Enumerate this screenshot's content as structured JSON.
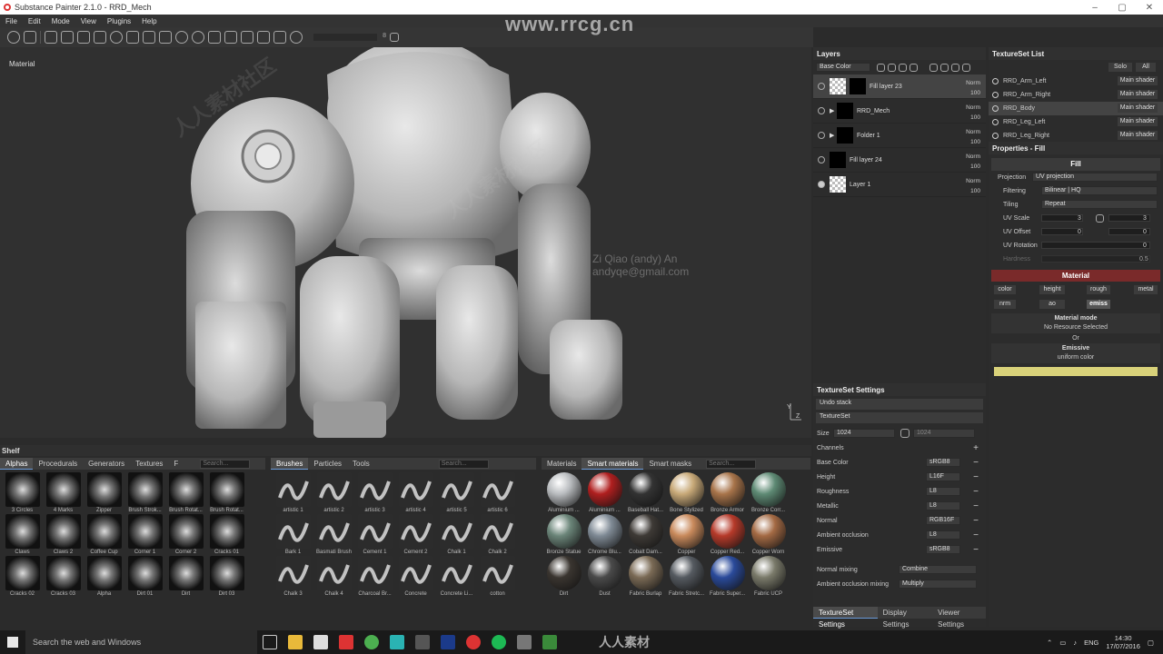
{
  "window": {
    "title": "Substance Painter 2.1.0 - RRD_Mech"
  },
  "watermark": {
    "site": "www.rrcg.cn",
    "cn": "人人素材社区",
    "logo_text": "人人素材",
    "author_name": "Zi Qiao (andy) An",
    "author_email": "andyqe@gmail.com"
  },
  "menu": [
    "File",
    "Edit",
    "Mode",
    "View",
    "Plugins",
    "Help"
  ],
  "toolbar": {
    "slider_value": "8"
  },
  "viewport": {
    "label": "Material",
    "gizmo_axes": "Y Z"
  },
  "shelf": {
    "title": "Shelf",
    "left_tabs": [
      "Alphas",
      "Procedurals",
      "Generators",
      "Textures",
      "F"
    ],
    "search_placeholder": "Search...",
    "alphas": [
      "3 Circles",
      "4 Marks",
      "Zipper",
      "Brush Strok...",
      "Brush Rotat...",
      "Brush Rotat...",
      "Claws",
      "Claws 2",
      "Coffee Cup",
      "Corner 1",
      "Corner 2",
      "Cracks 01",
      "Cracks 02",
      "Cracks 03",
      "Alpha",
      "Dirt 01",
      "Dirt",
      "Dirt 03"
    ],
    "mid_tabs": [
      "Brushes",
      "Particles",
      "Tools"
    ],
    "brushes": [
      "artistic 1",
      "artistic 2",
      "artistic 3",
      "artistic 4",
      "artistic 5",
      "artistic 6",
      "Bark 1",
      "Basmati Brush",
      "Cement 1",
      "Cement 2",
      "Chalk 1",
      "Chalk 2",
      "Chalk 3",
      "Chalk 4",
      "Charcoal Br...",
      "Concrete",
      "Concrete Li...",
      "cotton"
    ],
    "right_tabs": [
      "Materials",
      "Smart materials",
      "Smart masks"
    ],
    "materials": [
      {
        "label": "Aluminium ...",
        "color": "#b9bcbf"
      },
      {
        "label": "Aluminium ...",
        "color": "#b01f1f"
      },
      {
        "label": "Baseball Hat...",
        "color": "#333333"
      },
      {
        "label": "Bone Stylized",
        "color": "#c8a978"
      },
      {
        "label": "Bronze Armor",
        "color": "#a8744a"
      },
      {
        "label": "Bronze Corr...",
        "color": "#5e8a74"
      },
      {
        "label": "Bronze Statue",
        "color": "#6b8579"
      },
      {
        "label": "Chrome Blu...",
        "color": "#7f8a95"
      },
      {
        "label": "Cobalt Dam...",
        "color": "#3e3a36"
      },
      {
        "label": "Copper",
        "color": "#c98a5c"
      },
      {
        "label": "Copper Red...",
        "color": "#b63a2a"
      },
      {
        "label": "Copper Worn",
        "color": "#a46a44"
      },
      {
        "label": "Dirt",
        "color": "#3a3530"
      },
      {
        "label": "Dust",
        "color": "#4a4a4a"
      },
      {
        "label": "Fabric Burlap",
        "color": "#7a6a55"
      },
      {
        "label": "Fabric Stretc...",
        "color": "#555a60"
      },
      {
        "label": "Fabric Super...",
        "color": "#2a4a9a"
      },
      {
        "label": "Fabric UCP",
        "color": "#7a7a6a"
      }
    ]
  },
  "layers": {
    "title": "Layers",
    "channel": "Base Color",
    "items": [
      {
        "name": "Fill layer 23",
        "blend": "Norm",
        "opacity": "100"
      },
      {
        "name": "RRD_Mech",
        "blend": "Norm",
        "opacity": "100"
      },
      {
        "name": "Folder 1",
        "blend": "Norm",
        "opacity": "100"
      },
      {
        "name": "Fill layer 24",
        "blend": "Norm",
        "opacity": "100"
      },
      {
        "name": "Layer 1",
        "blend": "Norm",
        "opacity": "100"
      }
    ]
  },
  "textureset_settings": {
    "title": "TextureSet Settings",
    "undo": "Undo stack",
    "textureset": "TextureSet",
    "size_label": "Size",
    "size": "1024",
    "size2": "1024",
    "channels_label": "Channels",
    "channels": [
      {
        "name": "Base Color",
        "format": "sRGB8"
      },
      {
        "name": "Height",
        "format": "L16F"
      },
      {
        "name": "Roughness",
        "format": "L8"
      },
      {
        "name": "Metallic",
        "format": "L8"
      },
      {
        "name": "Normal",
        "format": "RGB16F"
      },
      {
        "name": "Ambient occlusion",
        "format": "L8"
      },
      {
        "name": "Emissive",
        "format": "sRGB8"
      }
    ],
    "normal_mixing_label": "Normal mixing",
    "normal_mixing": "Combine",
    "ao_mixing_label": "Ambient occlusion mixing",
    "ao_mixing": "Multiply",
    "bottom_tabs": [
      "TextureSet Settings",
      "Display Settings",
      "Viewer Settings"
    ]
  },
  "textureset_list": {
    "title": "TextureSet List",
    "solo": "Solo",
    "all": "All",
    "items": [
      {
        "name": "RRD_Arm_Left",
        "shader": "Main shader"
      },
      {
        "name": "RRD_Arm_Right",
        "shader": "Main shader"
      },
      {
        "name": "RRD_Body",
        "shader": "Main shader"
      },
      {
        "name": "RRD_Leg_Left",
        "shader": "Main shader"
      },
      {
        "name": "RRD_Leg_Right",
        "shader": "Main shader"
      }
    ]
  },
  "properties": {
    "title": "Properties - Fill",
    "fill": "Fill",
    "projection_label": "Projection",
    "projection": "UV projection",
    "filtering_label": "Filtering",
    "filtering": "Bilinear | HQ",
    "tiling_label": "Tiling",
    "tiling": "Repeat",
    "uvscale_label": "UV Scale",
    "uvscale": "3",
    "uvscale2": "3",
    "uvoffset_label": "UV Offset",
    "uvoffset": "0",
    "uvoffset2": "0",
    "uvrot_label": "UV Rotation",
    "uvrot": "0",
    "hardness_label": "Hardness",
    "hardness": "0.5",
    "material": "Material",
    "mat_buttons_row1": [
      "color",
      "height",
      "rough",
      "metal"
    ],
    "mat_buttons_row2": [
      "nrm",
      "ao",
      "emiss"
    ],
    "material_mode": "Material mode",
    "no_resource": "No Resource Selected",
    "or": "Or",
    "emissive": "Emissive",
    "uniform": "uniform color",
    "emissive_color": "#d9d27a"
  },
  "taskbar": {
    "search": "Search the web and Windows",
    "lang": "ENG",
    "time": "14:30",
    "date": "17/07/2016"
  }
}
